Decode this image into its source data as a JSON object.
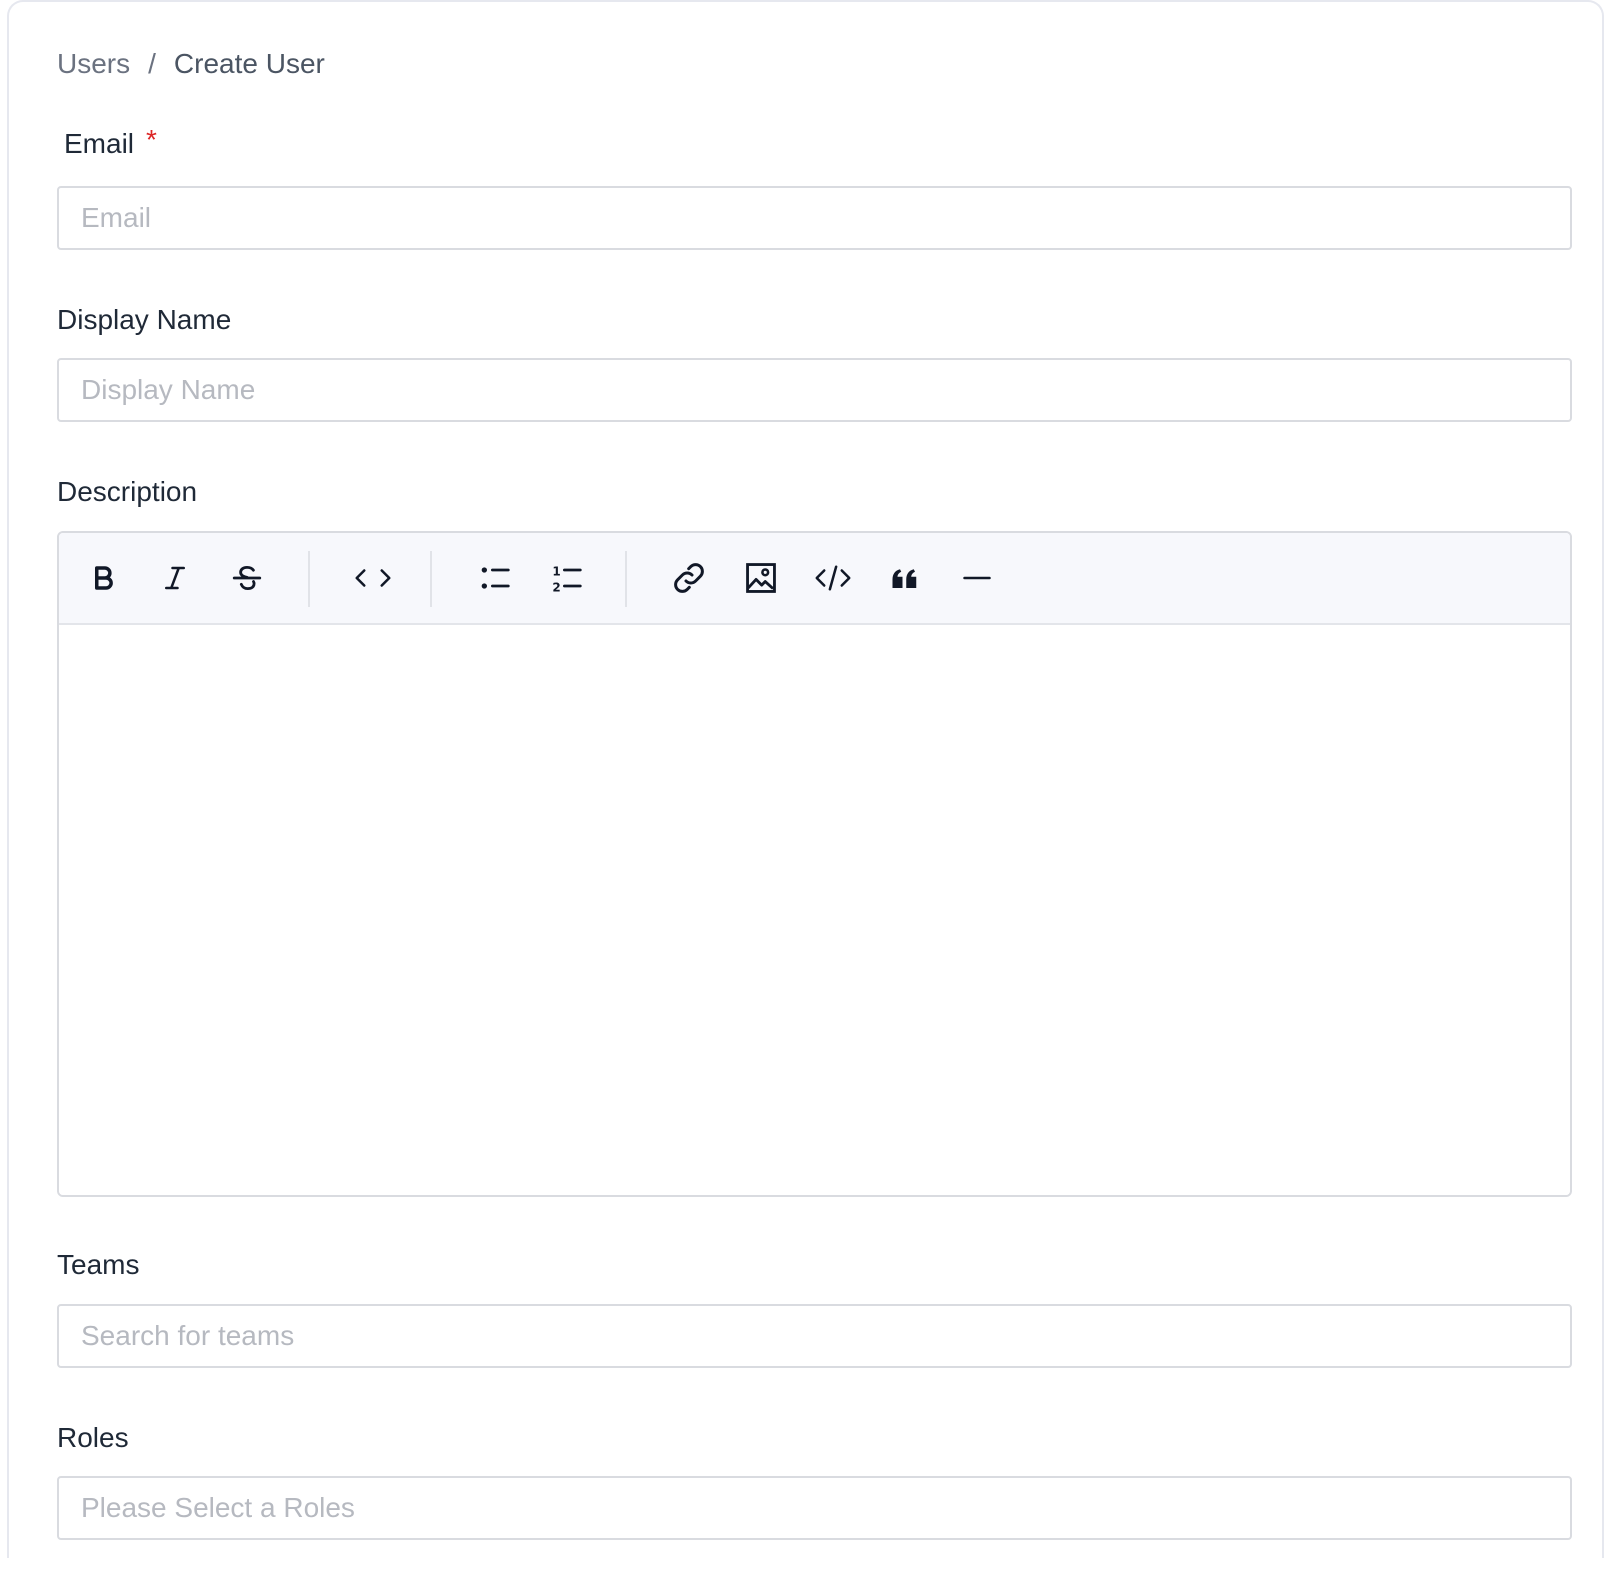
{
  "breadcrumb": {
    "parent": "Users",
    "separator": "/",
    "current": "Create User"
  },
  "form": {
    "email": {
      "label": "Email",
      "required_mark": "*",
      "placeholder": "Email",
      "value": ""
    },
    "display_name": {
      "label": "Display Name",
      "placeholder": "Display Name",
      "value": ""
    },
    "description": {
      "label": "Description",
      "toolbar": [
        {
          "name": "bold-icon"
        },
        {
          "name": "italic-icon"
        },
        {
          "name": "strikethrough-icon"
        },
        {
          "name": "inline-code-icon"
        },
        {
          "name": "bullet-list-icon"
        },
        {
          "name": "numbered-list-icon"
        },
        {
          "name": "link-icon"
        },
        {
          "name": "image-icon"
        },
        {
          "name": "code-block-icon"
        },
        {
          "name": "blockquote-icon"
        },
        {
          "name": "horizontal-rule-icon"
        }
      ],
      "value": ""
    },
    "teams": {
      "label": "Teams",
      "placeholder": "Search for teams",
      "value": ""
    },
    "roles": {
      "label": "Roles",
      "placeholder": "Please Select a Roles",
      "value": ""
    }
  },
  "colors": {
    "required": "#dc2626",
    "border": "#d9dbe0",
    "toolbar_bg": "#f7f8fc",
    "placeholder": "#b6b9c0"
  }
}
